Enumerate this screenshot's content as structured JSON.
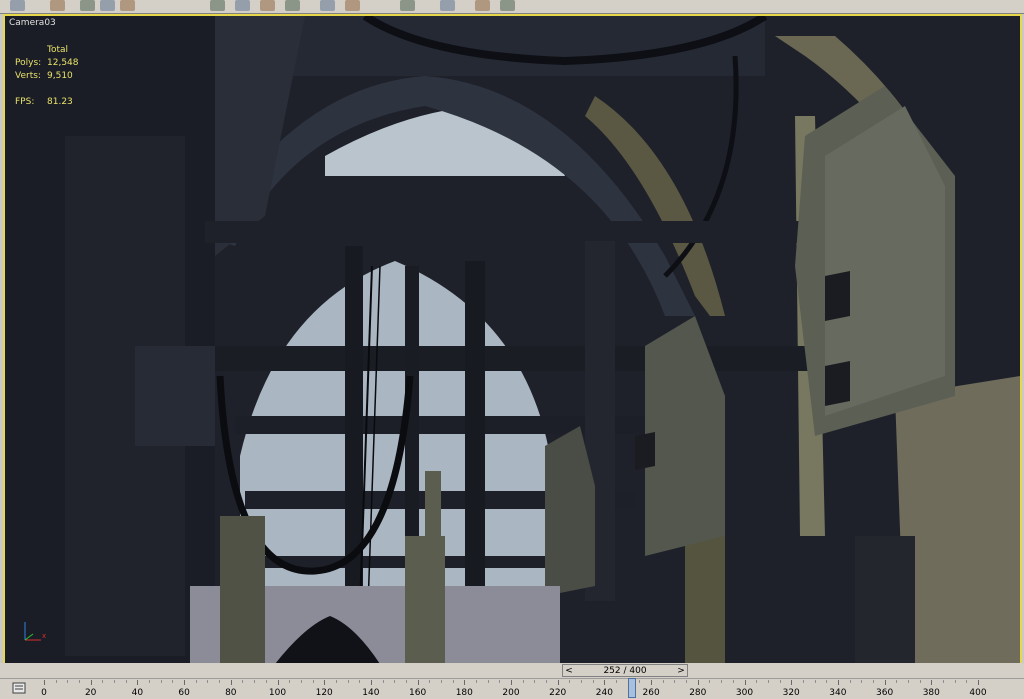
{
  "viewport": {
    "label": "Camera03",
    "stats": {
      "header": "Total",
      "rows": [
        {
          "label": "Polys:",
          "value": "12,548"
        },
        {
          "label": "Verts:",
          "value": "9,510"
        }
      ],
      "fps_label": "FPS:",
      "fps_value": "81.23"
    },
    "border_color": "#e6d84a"
  },
  "timeline": {
    "frame_counter": "252 / 400",
    "prev_label": "<",
    "next_label": ">",
    "current_frame": 252,
    "total_frames": 400,
    "ticks": [
      "0",
      "20",
      "40",
      "60",
      "80",
      "100",
      "120",
      "140",
      "160",
      "180",
      "200",
      "220",
      "240",
      "260",
      "280",
      "300",
      "320",
      "340",
      "360",
      "380",
      "400"
    ]
  },
  "toolbar": {
    "icons": [
      "select-icon",
      "select-object-icon",
      "select-region-icon",
      "window-crossing-icon",
      "move-icon",
      "rotate-icon",
      "scale-icon",
      "mirror-icon",
      "align-icon",
      "snap-icon",
      "angle-snap-icon",
      "percent-snap-icon",
      "material-editor-icon",
      "render-scene-icon",
      "quick-render-icon"
    ]
  }
}
